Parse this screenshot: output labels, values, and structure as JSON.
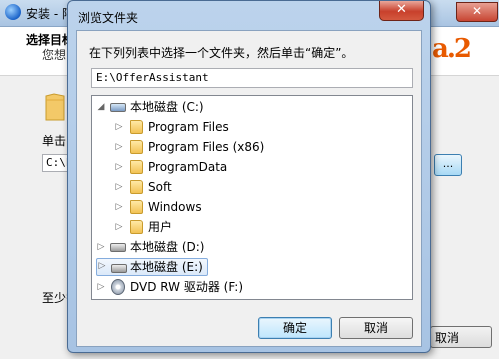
{
  "installer": {
    "title": "安装 - 阿",
    "heading": "选择目标",
    "subheading": "您想",
    "hint_label": "单击",
    "path_value": "C:\\P",
    "browse_label": "...",
    "space_text": "至少需",
    "cancel_label": "取消",
    "close_label": "✕",
    "logo_text": "a.2"
  },
  "dialog": {
    "title": "浏览文件夹",
    "close_label": "✕",
    "prompt": "在下列列表中选择一个文件夹，然后单击“确定”。",
    "path_value": "E:\\OfferAssistant",
    "tree": {
      "drive_c": "本地磁盘 (C:)",
      "c_children": [
        "Program Files",
        "Program Files (x86)",
        "ProgramData",
        "Soft",
        "Windows",
        "用户"
      ],
      "drive_d": "本地磁盘 (D:)",
      "drive_e": "本地磁盘 (E:)",
      "drive_f": "DVD RW 驱动器 (F:)",
      "expand_glyph": "▷",
      "collapse_glyph": "◢"
    },
    "ok_label": "确定",
    "cancel_label": "取消"
  }
}
